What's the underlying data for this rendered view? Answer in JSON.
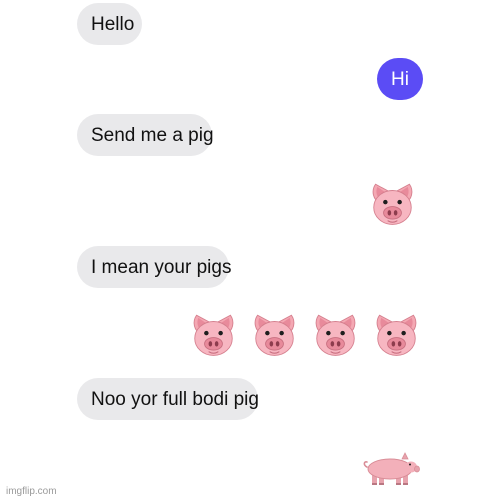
{
  "conversation": {
    "messages": [
      {
        "side": "incoming",
        "type": "text",
        "text": "Hello"
      },
      {
        "side": "outgoing",
        "type": "text",
        "text": "Hi"
      },
      {
        "side": "incoming",
        "type": "text",
        "text": "Send me a pig"
      },
      {
        "side": "outgoing",
        "type": "emoji",
        "emoji": "pig-face-icon",
        "count": 1
      },
      {
        "side": "incoming",
        "type": "text",
        "text": "I mean your pigs"
      },
      {
        "side": "outgoing",
        "type": "emoji",
        "emoji": "pig-face-icon",
        "count": 4
      },
      {
        "side": "incoming",
        "type": "text",
        "text": "Noo yor full bodi pig"
      },
      {
        "side": "outgoing",
        "type": "emoji",
        "emoji": "pig-icon",
        "count": 1
      }
    ]
  },
  "colors": {
    "incoming_bubble": "#e9e9eb",
    "outgoing_bubble": "#5b4cf5",
    "incoming_text": "#111111",
    "outgoing_text": "#ffffff",
    "pig_pink": "#f4a8b3"
  },
  "watermark": {
    "text": "imgflip.com"
  }
}
